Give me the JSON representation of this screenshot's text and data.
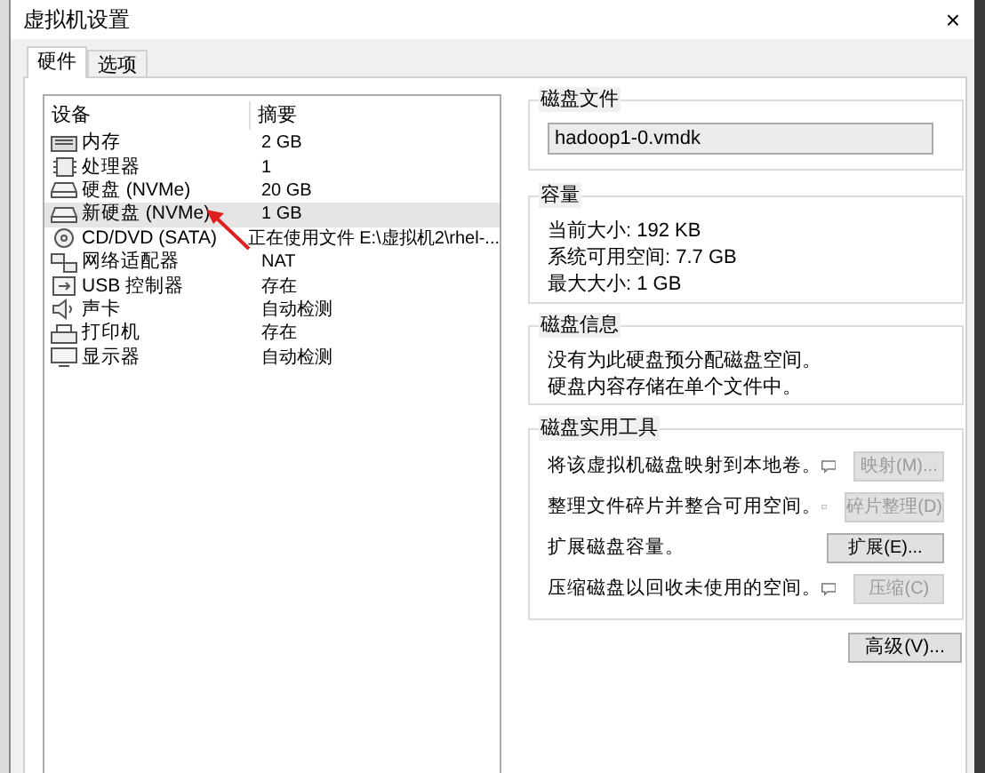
{
  "window": {
    "title": "虚拟机设置",
    "close": "×"
  },
  "tabs": [
    {
      "label": "硬件",
      "selected": true
    },
    {
      "label": "选项",
      "selected": false
    }
  ],
  "devices": {
    "columns": [
      "设备",
      "摘要"
    ],
    "rows": [
      {
        "kind": "memory",
        "name": "内存",
        "summary": "2 GB",
        "selected": false
      },
      {
        "kind": "cpu",
        "name": "处理器",
        "summary": "1",
        "selected": false
      },
      {
        "kind": "disk",
        "name": "硬盘 (NVMe)",
        "summary": "20 GB",
        "selected": false
      },
      {
        "kind": "disk",
        "name": "新硬盘 (NVMe)",
        "summary": "1 GB",
        "selected": true
      },
      {
        "kind": "cd",
        "name": "CD/DVD (SATA)",
        "summary": "正在使用文件 E:\\虚拟机2\\rhel-...",
        "selected": false
      },
      {
        "kind": "network",
        "name": "网络适配器",
        "summary": "NAT",
        "selected": false
      },
      {
        "kind": "usb",
        "name": "USB 控制器",
        "summary": "存在",
        "selected": false
      },
      {
        "kind": "sound",
        "name": "声卡",
        "summary": "自动检测",
        "selected": false
      },
      {
        "kind": "printer",
        "name": "打印机",
        "summary": "存在",
        "selected": false
      },
      {
        "kind": "display",
        "name": "显示器",
        "summary": "自动检测",
        "selected": false
      }
    ]
  },
  "disk_file": {
    "title": "磁盘文件",
    "value": "hadoop1-0.vmdk"
  },
  "capacity": {
    "title": "容量",
    "lines": [
      "当前大小: 192 KB",
      "系统可用空间: 7.7 GB",
      "最大大小: 1 GB"
    ]
  },
  "disk_info": {
    "title": "磁盘信息",
    "lines": [
      "没有为此硬盘预分配磁盘空间。",
      "硬盘内容存储在单个文件中。"
    ]
  },
  "utilities": {
    "title": "磁盘实用工具",
    "items": [
      {
        "text": "将该虚拟机磁盘映射到本地卷。",
        "button": "映射(M)...",
        "disabled": true
      },
      {
        "text": "整理文件碎片并整合可用空间。",
        "button": "碎片整理(D)",
        "disabled": true
      },
      {
        "text": "扩展磁盘容量。",
        "button": "扩展(E)...",
        "disabled": false
      },
      {
        "text": "压缩磁盘以回收未使用的空间。",
        "button": "压缩(C)",
        "disabled": true
      }
    ]
  },
  "advanced_button": "高级(V)..."
}
